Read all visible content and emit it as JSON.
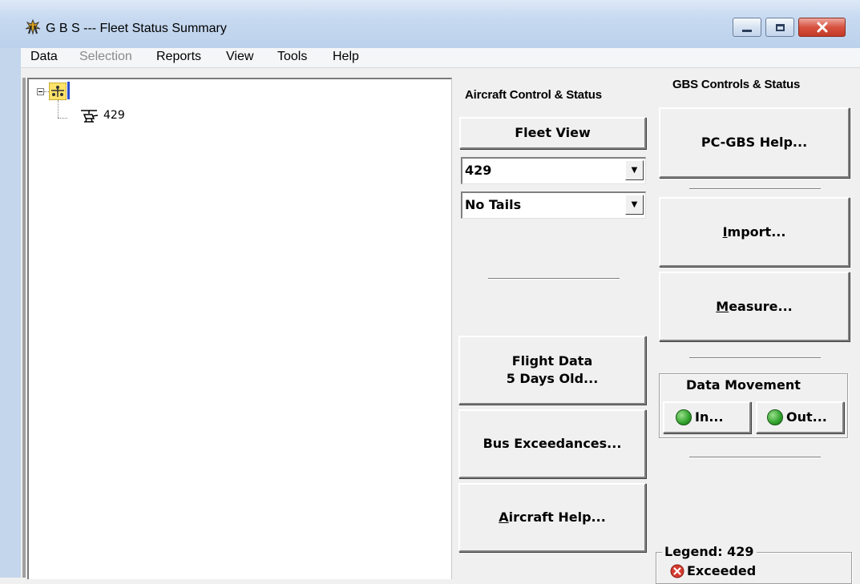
{
  "window": {
    "title": "G B S --- Fleet Status Summary",
    "icon": "gbs-app-icon"
  },
  "menu": {
    "items": [
      "Data",
      "Selection",
      "Reports",
      "View",
      "Tools",
      "Help"
    ],
    "disabled": [
      "Selection"
    ]
  },
  "tree": {
    "root_icon": "fleet-root-icon",
    "children": [
      {
        "icon": "helicopter-icon",
        "label": "429"
      }
    ]
  },
  "aircraft_panel": {
    "title": "Aircraft Control & Status",
    "fleet_view_label": "Fleet View",
    "aircraft_select_value": "429",
    "tails_select_value": "No Tails",
    "flight_data_line1": "Flight Data",
    "flight_data_line2": "5 Days Old...",
    "bus_exceedances_label": "Bus Exceedances...",
    "aircraft_help_label": "Aircraft Help..."
  },
  "gbs_panel": {
    "title": "GBS Controls & Status",
    "help_label": "PC-GBS Help...",
    "import_label": "Import...",
    "measure_label": "Measure...",
    "data_movement_label": "Data Movement",
    "in_label": "In...",
    "out_label": "Out...",
    "legend_label": "Legend: 429",
    "legend_exceeded_label": "Exceeded"
  },
  "colors": {
    "led_green": "#2ea12a",
    "exceeded_red": "#d63b2f",
    "titlebar": "#c6d9f0"
  }
}
